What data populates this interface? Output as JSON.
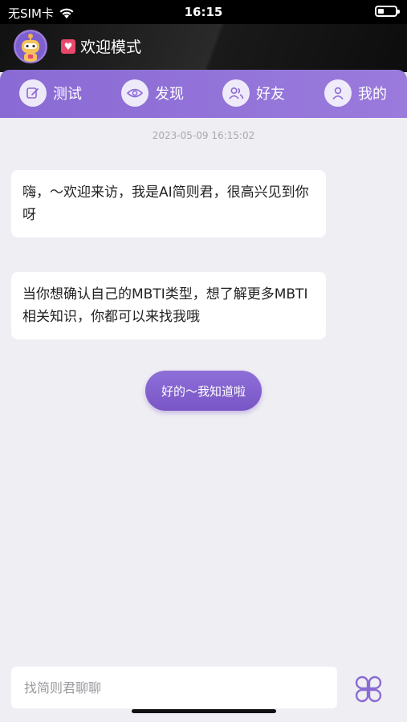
{
  "status_bar": {
    "carrier": "无SIM卡",
    "time": "16:15"
  },
  "header": {
    "title": "欢迎模式"
  },
  "nav": {
    "items": [
      {
        "label": "测试",
        "icon": "edit-icon"
      },
      {
        "label": "发现",
        "icon": "eye-icon"
      },
      {
        "label": "好友",
        "icon": "friends-icon"
      },
      {
        "label": "我的",
        "icon": "user-icon"
      }
    ]
  },
  "chat": {
    "timestamp": "2023-05-09 16:15:02",
    "messages": [
      {
        "text": "嗨，～欢迎来访，我是AI简则君，很高兴见到你呀"
      },
      {
        "text": "当你想确认自己的MBTI类型，想了解更多MBTI相关知识，你都可以来找我哦"
      }
    ],
    "quick_reply": "好的～我知道啦"
  },
  "input": {
    "placeholder": "找简则君聊聊",
    "value": ""
  },
  "colors": {
    "accent": "#8a6ad4",
    "background": "#efeef3"
  }
}
